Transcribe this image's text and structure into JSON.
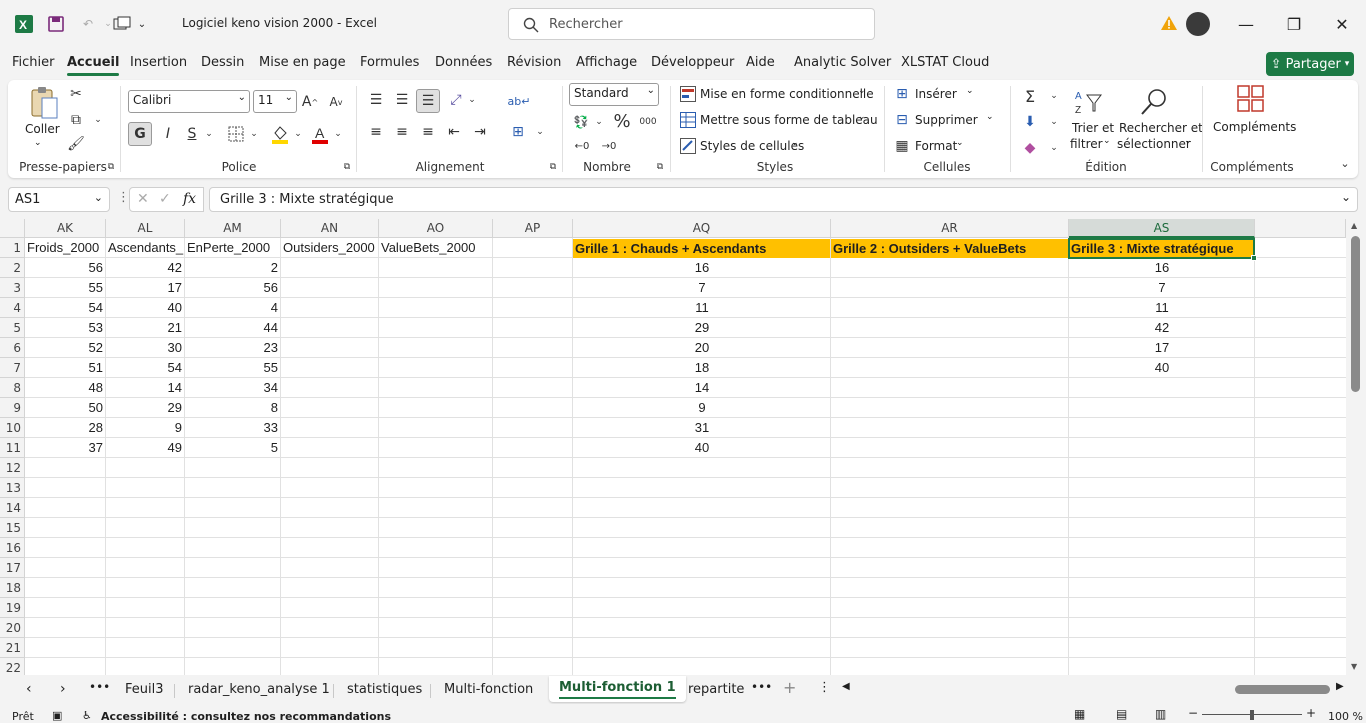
{
  "titlebar": {
    "title": "Logiciel keno vision 2000  -  Excel",
    "search_placeholder": "Rechercher"
  },
  "menu": {
    "tabs": [
      "Fichier",
      "Accueil",
      "Insertion",
      "Dessin",
      "Mise en page",
      "Formules",
      "Données",
      "Révision",
      "Affichage",
      "Développeur",
      "Aide",
      "Analytic Solver",
      "XLSTAT Cloud"
    ],
    "active": "Accueil",
    "share": "Partager"
  },
  "ribbon": {
    "clipboard": {
      "paste": "Coller",
      "label": "Presse-papiers"
    },
    "font": {
      "name": "Calibri",
      "size": "11",
      "bold": "G",
      "italic": "I",
      "underline": "S",
      "label": "Police"
    },
    "alignment": {
      "label": "Alignement"
    },
    "number": {
      "format": "Standard",
      "percent": "%",
      "thousands": "000",
      "label": "Nombre"
    },
    "styles": {
      "conditional": "Mise en forme conditionnelle",
      "table": "Mettre sous forme de tableau",
      "cell_styles": "Styles de cellules",
      "label": "Styles"
    },
    "cells": {
      "insert": "Insérer",
      "delete": "Supprimer",
      "format": "Format",
      "label": "Cellules"
    },
    "editing": {
      "sort_1": "Trier et",
      "sort_2": "filtrer",
      "find_1": "Rechercher et",
      "find_2": "sélectionner",
      "label": "Édition"
    },
    "addins": {
      "button": "Compléments",
      "label": "Compléments"
    }
  },
  "formula_bar": {
    "name_box": "AS1",
    "fx": "fx",
    "content": "Grille 3 : Mixte stratégique"
  },
  "sheet": {
    "columns": [
      "AK",
      "AL",
      "AM",
      "AN",
      "AO",
      "AP",
      "AQ",
      "AR",
      "AS"
    ],
    "selected_column": "AS",
    "rows": [
      "1",
      "2",
      "3",
      "4",
      "5",
      "6",
      "7",
      "8",
      "9",
      "10",
      "11",
      "12",
      "13",
      "14",
      "15",
      "16",
      "17",
      "18",
      "19",
      "20",
      "21",
      "22"
    ],
    "header_row": {
      "AK": "Froids_2000",
      "AL": "Ascendants_",
      "AM": "EnPerte_2000",
      "AN": "Outsiders_2000",
      "AO": "ValueBets_2000",
      "AQ": "Grille 1 : Chauds + Ascendants",
      "AR": "Grille 2 : Outsiders + ValueBets",
      "AS": "Grille 3 : Mixte stratégique"
    },
    "AK": [
      "56",
      "55",
      "54",
      "53",
      "52",
      "51",
      "48",
      "50",
      "28",
      "37"
    ],
    "AL": [
      "42",
      "17",
      "40",
      "21",
      "30",
      "54",
      "14",
      "29",
      "9",
      "49"
    ],
    "AM": [
      "2",
      "56",
      "4",
      "44",
      "23",
      "55",
      "34",
      "8",
      "33",
      "5"
    ],
    "AQ": [
      "16",
      "7",
      "11",
      "29",
      "20",
      "18",
      "14",
      "9",
      "31",
      "40"
    ],
    "AS": [
      "16",
      "7",
      "11",
      "42",
      "17",
      "40"
    ],
    "highlight_color": "#ffc000",
    "accent_color": "#1d7a45"
  },
  "sheet_tabs": {
    "tabs": [
      "Feuil3",
      "radar_keno_analyse 1",
      "statistiques",
      "Multi-fonction",
      "Multi-fonction 1",
      "repartite"
    ],
    "active": "Multi-fonction 1"
  },
  "statusbar": {
    "ready": "Prêt",
    "accessibility": "Accessibilité : consultez nos recommandations",
    "zoom": "100 %"
  }
}
